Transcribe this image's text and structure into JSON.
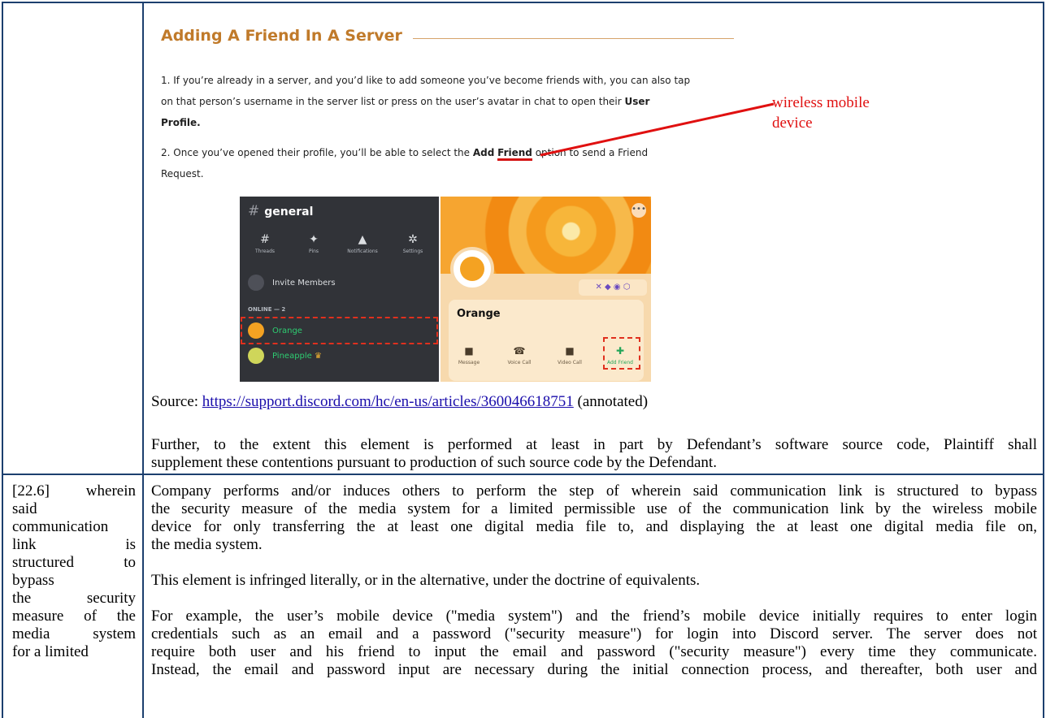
{
  "discord_article": {
    "heading": "Adding A Friend In A Server",
    "step1": {
      "line1": "1. If you’re already in a server, and you’d like to add someone you’ve become friends with, you can also tap",
      "line2": "on that person’s username in the server list or press on the user’s avatar in chat to open their",
      "bold1": "User",
      "bold2": "Profile."
    },
    "step2": {
      "pre": "2. Once you’ve opened their profile, you’ll be able to select the",
      "bold_a": "Add",
      "bold_b": "Friend",
      "post": "option to send a Friend",
      "line2": "Request."
    }
  },
  "annotation": {
    "line1": "wireless mobile",
    "line2": "device",
    "color": "#e01010"
  },
  "screenshot": {
    "channel": "general",
    "tools": [
      "Threads",
      "Pins",
      "Notifications",
      "Settings"
    ],
    "invite": "Invite Members",
    "online_label": "ONLINE — 2",
    "members": [
      "Orange",
      "Pineapple"
    ],
    "profile_name": "Orange",
    "actions": [
      "Message",
      "Voice Call",
      "Video Call",
      "Add Friend"
    ]
  },
  "source": {
    "prefix": "Source:",
    "url": "https://support.discord.com/hc/en-us/articles/360046618751",
    "suffix": "(annotated)"
  },
  "further": {
    "line1": "Further, to the extent this element is performed at least in part by Defendant’s software source code, Plaintiff shall",
    "line2": "supplement these contentions pursuant to production of such source code by the Defendant."
  },
  "claim_left": {
    "l1": "[22.6] wherein",
    "l2": "said",
    "l3": "communication",
    "l4": "link is",
    "l5": "structured to",
    "l6": "bypass",
    "l7": "the security",
    "l8": "measure of the",
    "l9": "media system",
    "l10": "for a limited"
  },
  "claim_right": {
    "p1": {
      "l1": "Company performs and/or induces others to perform the step of wherein said communication link is structured to bypass",
      "l2": "the security measure of the media system for a limited permissible use of the communication link by the wireless mobile",
      "l3": "device for only transferring the at least one digital media file to, and displaying the at least one digital media file on,",
      "l4": "the media system."
    },
    "p2": "This element is infringed literally, or in the alternative, under the doctrine of equivalents.",
    "p3": {
      "l1": "For example, the user’s mobile device (\"media system\") and the friend’s mobile device initially requires to enter login",
      "l2": "credentials such as an email and a password (\"security measure\") for login into Discord server. The server does not",
      "l3": "require both user and his friend to input the email and password (\"security measure\") every time they communicate.",
      "l4": "Instead, the email and password input are necessary during the initial connection process, and thereafter, both user and"
    }
  }
}
